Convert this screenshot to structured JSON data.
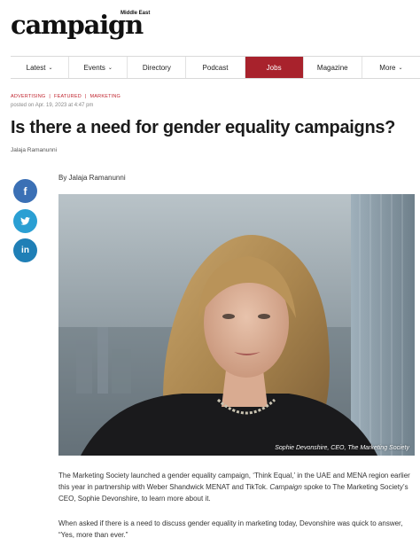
{
  "header": {
    "logo_word": "campaign",
    "logo_sub": "Middle East"
  },
  "nav": {
    "items": [
      {
        "label": "Latest",
        "dropdown": true
      },
      {
        "label": "Events",
        "dropdown": true
      },
      {
        "label": "Directory",
        "dropdown": false
      },
      {
        "label": "Podcast",
        "dropdown": false
      },
      {
        "label": "Jobs",
        "dropdown": false,
        "active": true
      },
      {
        "label": "Magazine",
        "dropdown": false
      },
      {
        "label": "More",
        "dropdown": true
      }
    ],
    "active_color": "#a8222c"
  },
  "article": {
    "categories": [
      "ADVERTISING",
      "FEATURED",
      "MARKETING"
    ],
    "posted": "posted on Apr. 19, 2023 at 4:47 pm",
    "title": "Is there a need for gender equality campaigns?",
    "author_top": "Jalaja Ramanunni",
    "byline": "By Jalaja Ramanunni",
    "image_caption": "Sophie Devonshire, CEO, The Marketing Society",
    "para1_a": "The Marketing Society launched a gender equality campaign, ‘Think Equal,’ in the UAE and MENA region earlier this year in partnership with Weber Shandwick MENAT and TikTok. ",
    "para1_em": "Campaign",
    "para1_b": " spoke to The Marketing Society’s CEO, Sophie Devonshire, to learn more about it.",
    "para2": "When asked if there is a need to discuss gender equality in marketing today, Devonshire was quick to answer, “Yes, more than ever.”"
  },
  "social": {
    "facebook": "f",
    "twitter": "t",
    "linkedin": "in",
    "colors": {
      "facebook": "#3b70b5",
      "twitter": "#2a9fd3",
      "linkedin": "#1f7fb6"
    }
  }
}
